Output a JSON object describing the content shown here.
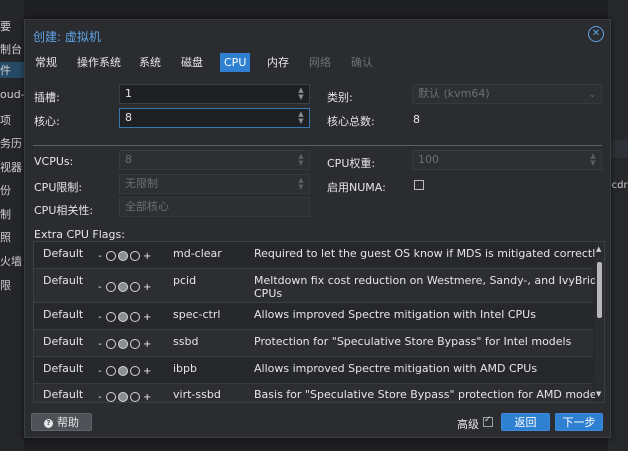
{
  "background": {
    "left_items": [
      "要",
      "制台",
      "件",
      "oud-I",
      "项",
      "务历",
      "视器",
      "份",
      "制",
      "照",
      "火墙",
      "限"
    ],
    "right_text": "-cdr"
  },
  "dialog": {
    "title": "创建: 虚拟机",
    "tabs": [
      "常规",
      "操作系统",
      "系统",
      "磁盘",
      "CPU",
      "内存",
      "网络",
      "确认"
    ],
    "active_tab": "CPU"
  },
  "cpu": {
    "sockets_label": "插槽:",
    "sockets_value": "1",
    "cores_label": "核心:",
    "cores_value": "8",
    "type_label": "类别:",
    "type_value": "默认 (kvm64)",
    "total_cores_label": "核心总数:",
    "total_cores_value": "8"
  },
  "advanced": {
    "vcpus_label": "VCPUs:",
    "vcpus_value": "8",
    "cpu_weight_label": "CPU权重:",
    "cpu_weight_value": "100",
    "cpu_limit_label": "CPU限制:",
    "cpu_limit_value": "无限制",
    "numa_label": "启用NUMA:",
    "affinity_label": "CPU相关性:",
    "affinity_value": "全部核心"
  },
  "flags": {
    "title": "Extra CPU Flags:",
    "rows": [
      {
        "state": "Default",
        "name": "md-clear",
        "desc": "Required to let the guest OS know if MDS is mitigated correctly"
      },
      {
        "state": "Default",
        "name": "pcid",
        "desc": "Meltdown fix cost reduction on Westmere, Sandy-, and IvyBridge Intel",
        "desc2": "CPUs"
      },
      {
        "state": "Default",
        "name": "spec-ctrl",
        "desc": "Allows improved Spectre mitigation with Intel CPUs"
      },
      {
        "state": "Default",
        "name": "ssbd",
        "desc": "Protection for \"Speculative Store Bypass\" for Intel models"
      },
      {
        "state": "Default",
        "name": "ibpb",
        "desc": "Allows improved Spectre mitigation with AMD CPUs"
      },
      {
        "state": "Default",
        "name": "virt-ssbd",
        "desc": "Basis for \"Speculative Store Bypass\" protection for AMD models"
      }
    ],
    "minus": "-",
    "plus": "+"
  },
  "footer": {
    "help_label": "帮助",
    "advanced_label": "高级",
    "back_label": "返回",
    "next_label": "下一步"
  }
}
